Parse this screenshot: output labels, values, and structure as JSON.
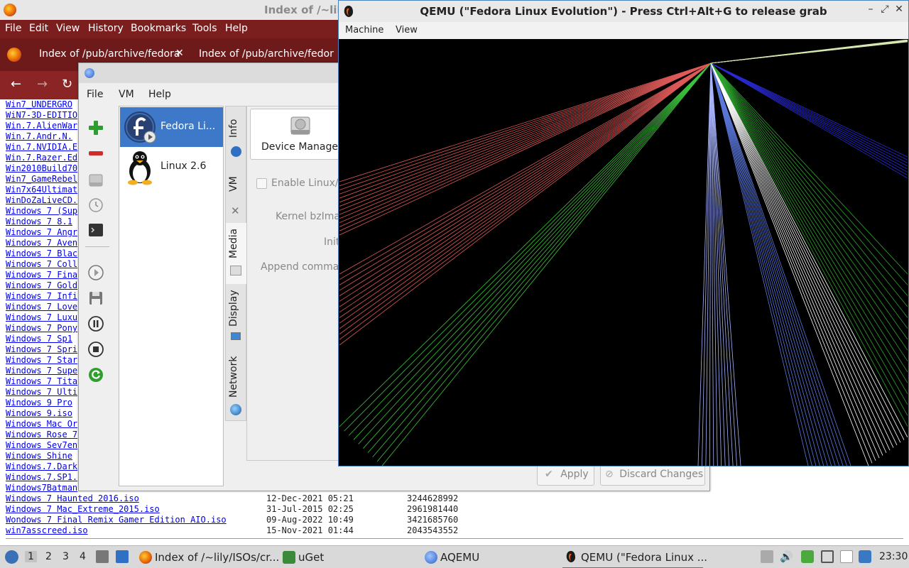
{
  "firefox": {
    "title": "Index of /~lil",
    "menu": [
      "File",
      "Edit",
      "View",
      "History",
      "Bookmarks",
      "Tools",
      "Help"
    ],
    "tabs": [
      "Index of /pub/archive/fedora",
      "Index of /pub/archive/fedora"
    ],
    "listing_names": [
      "Win7_UNDERGRO",
      "WiN7-3D-EDITIO",
      "Win.7.AlienWar",
      "Win.7.Andr.N.",
      "Win.7.NVIDIA.E",
      "Win.7.Razer.Ed",
      "Win2010Build70",
      "Win7_GameRebel",
      "Win7x64Ultimat",
      "WinDoZaLiveCD.",
      "Windows 7 (Sup",
      "Windows 7 8.1",
      "Windows 7 Angr",
      "Windows 7 Aven",
      "Windows 7 Blac",
      "Windows 7 Coll",
      "Windows 7 Fina",
      "Windows 7 Gold",
      "Windows 7 Infi",
      "Windows 7 Love",
      "Windows 7 Luxu",
      "Windows 7 Pony",
      "Windows 7 Sp1",
      "Windows 7 Spri",
      "Windows 7 Star",
      "Windows 7 Supe",
      "Windows 7 Tita",
      "Windows 7 Ulti",
      "Windows 9 Pro",
      "Windows 9.iso",
      "Windows Mac Or",
      "Windows Rose 7",
      "Windows Sev7en",
      "Windows Shine",
      "Windows.7.Dark",
      "Windows.7.SP1.",
      "Windows7Batman"
    ],
    "listing_full": [
      {
        "name": "Windows 7 Haunted 2016.iso",
        "date": "12-Dec-2021 05:21",
        "size": "3244628992"
      },
      {
        "name": "Windows 7 Mac_Extreme_2015.iso",
        "date": "31-Jul-2015 02:25",
        "size": "2961981440"
      },
      {
        "name": "Wondows 7 Final Remix Gamer Edition AIO.iso",
        "date": "09-Aug-2022 10:49",
        "size": "3421685760"
      },
      {
        "name": "win7asscreed.iso",
        "date": "15-Nov-2021 01:44",
        "size": "2043543552"
      }
    ]
  },
  "aqemu": {
    "menu": [
      "File",
      "VM",
      "Help"
    ],
    "vms": [
      {
        "name": "Fedora Li...",
        "selected": true,
        "icon": "fedora-icon"
      },
      {
        "name": "Linux 2.6",
        "selected": false,
        "icon": "tux-icon"
      }
    ],
    "tabs": [
      "Info",
      "VM",
      "Media",
      "Display",
      "Network"
    ],
    "active_tab": "Media",
    "device_manager_label": "Device Manager",
    "enable_linux_label": "Enable Linux/I",
    "kernel_label": "Kernel bzIma",
    "initrd_label": "Init",
    "append_label": "Append comma",
    "apply_label": "Apply",
    "discard_label": "Discard Changes"
  },
  "qemu": {
    "title": "QEMU (\"Fedora Linux Evolution\") - Press Ctrl+Alt+G to release grab",
    "menu": [
      "Machine",
      "View"
    ]
  },
  "taskbar": {
    "workspaces": [
      "1",
      "2",
      "3",
      "4"
    ],
    "current_workspace": "1",
    "tasks": [
      "Index of /~lily/ISOs/cr...",
      "uGet",
      "AQEMU",
      "QEMU (\"Fedora Linux ..."
    ],
    "clock": "23:30"
  },
  "colors": {
    "firefox_menu": "#7b1e1e",
    "selection": "#3d78c9",
    "qemu_border": "#4a7fc0",
    "link": "#0000ee"
  }
}
